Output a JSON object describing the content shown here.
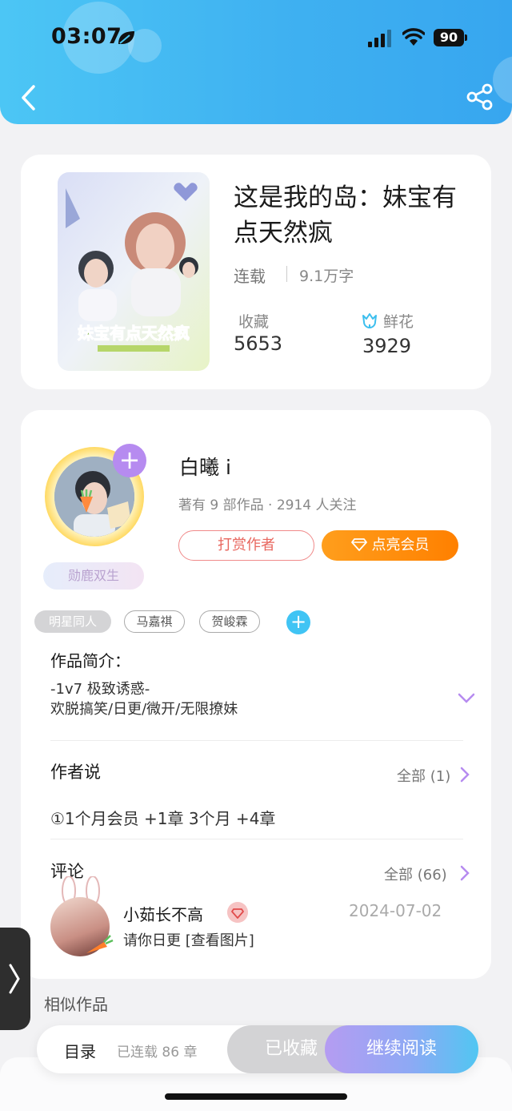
{
  "status_bar": {
    "time": "03:07",
    "battery": "90"
  },
  "book": {
    "title": "这是我的岛：妹宝有点天然疯",
    "status": "连载",
    "words": "9.1万字",
    "favorites_label": "收藏",
    "favorites_count": "5653",
    "flowers_label": "鲜花",
    "flowers_count": "3929",
    "cover_text": "妹宝有点天然疯"
  },
  "author": {
    "name": "白曦 i",
    "meta": "著有 9 部作品 · 2914 人关注",
    "badge": "勋鹿双生",
    "tip_button": "打赏作者",
    "vip_button": "点亮会员"
  },
  "tags": {
    "category": "明星同人",
    "items": [
      "马嘉祺",
      "贺峻霖"
    ]
  },
  "intro": {
    "title": "作品简介：",
    "lines": [
      "-1v7 极致诱惑-",
      "欢脱搞笑/日更/微开/无限撩妹"
    ]
  },
  "author_says": {
    "title": "作者说",
    "more": "全部 (1)",
    "text": "①1个月会员 +1章  3个月 +4章"
  },
  "comments": {
    "title": "评论",
    "more": "全部 (66)",
    "first": {
      "user": "小茹长不高",
      "date": "2024-07-02",
      "text": "请你日更 [查看图片]"
    }
  },
  "similar": "相似作品",
  "bottom_bar": {
    "toc": "目录",
    "serial": "已连载 86 章",
    "collected": "已收藏",
    "read": "继续阅读"
  },
  "colors": {
    "header": "#3fb1f1",
    "vip_orange": "#ff8000",
    "tip_red": "#e8675f",
    "purple": "#b68bf0"
  }
}
